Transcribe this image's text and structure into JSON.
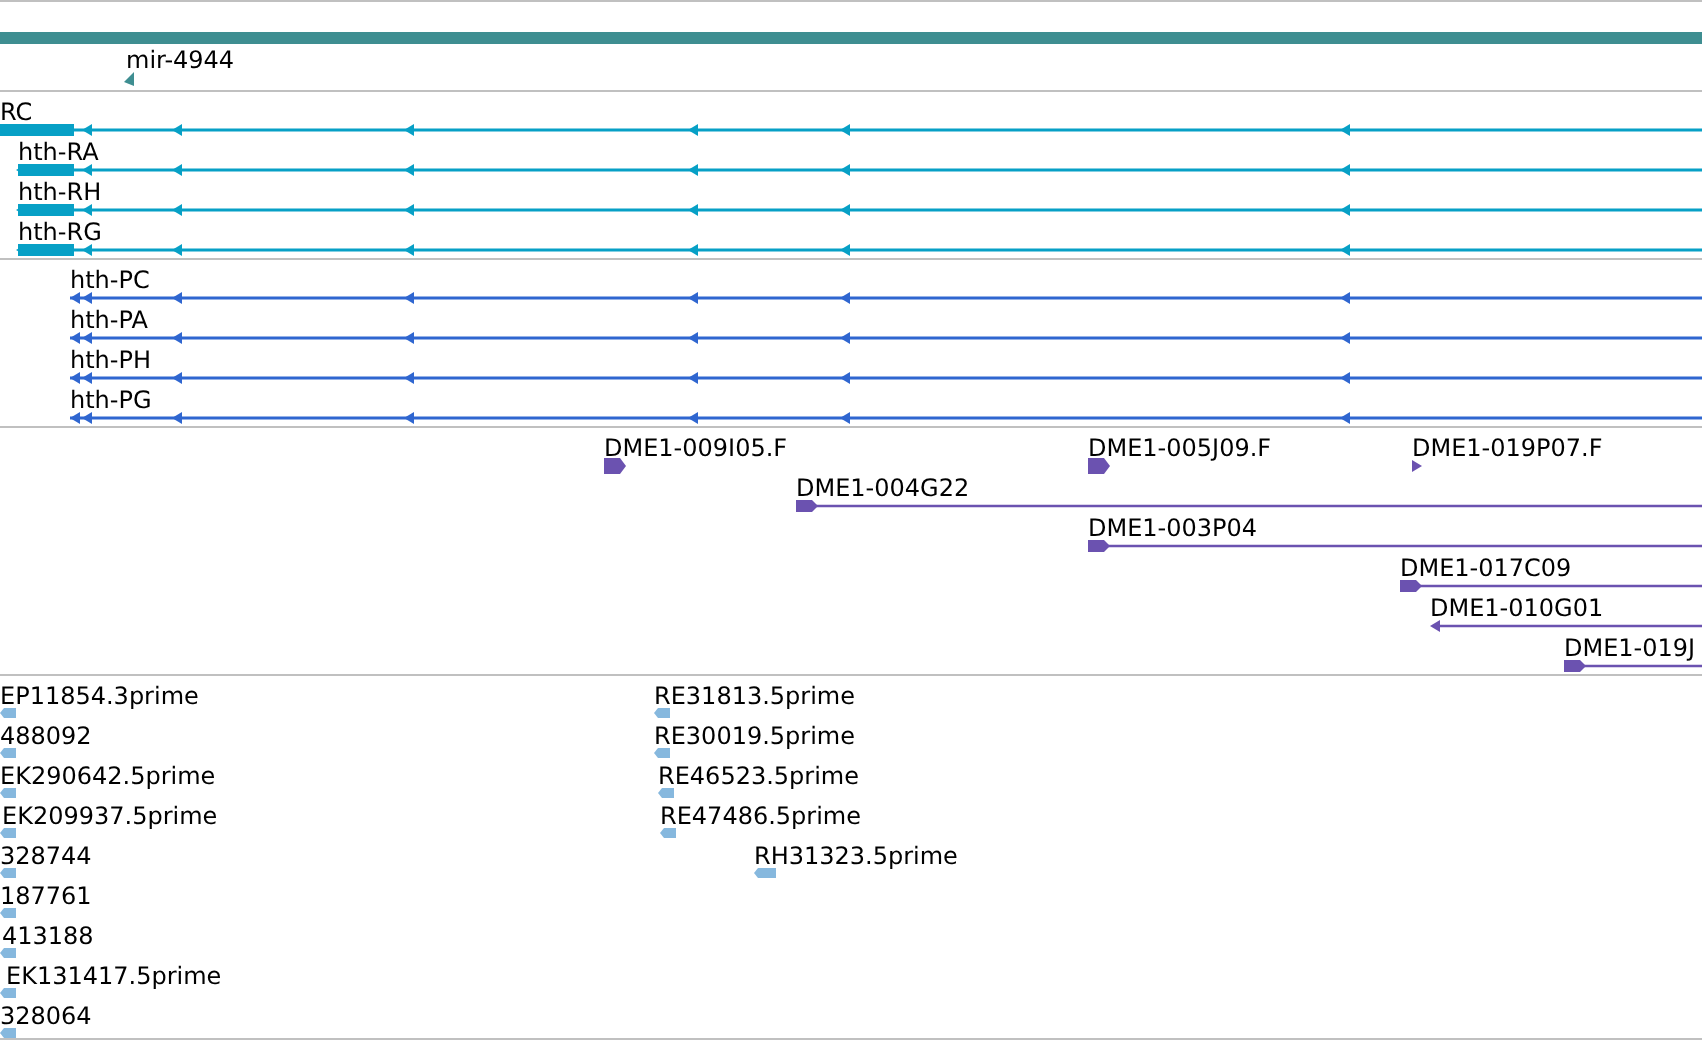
{
  "mirna": [
    {
      "label": "mir-4944"
    }
  ],
  "transcripts": [
    {
      "label": "RC"
    },
    {
      "label": "hth-RA"
    },
    {
      "label": "hth-RH"
    },
    {
      "label": "hth-RG"
    }
  ],
  "proteins": [
    {
      "label": "hth-PC"
    },
    {
      "label": "hth-PA"
    },
    {
      "label": "hth-PH"
    },
    {
      "label": "hth-PG"
    }
  ],
  "ests": [
    {
      "label": "DME1-009I05.F",
      "kind": "block"
    },
    {
      "label": "DME1-005J09.F",
      "kind": "block"
    },
    {
      "label": "DME1-019P07.F",
      "kind": "tick"
    },
    {
      "label": "DME1-004G22",
      "kind": "line"
    },
    {
      "label": "DME1-003P04",
      "kind": "line"
    },
    {
      "label": "DME1-017C09",
      "kind": "line"
    },
    {
      "label": "DME1-010G01",
      "kind": "reverse"
    },
    {
      "label": "DME1-019J",
      "kind": "line"
    }
  ],
  "reads": [
    {
      "label": "EP11854.3prime"
    },
    {
      "label": "488092"
    },
    {
      "label": "EK290642.5prime"
    },
    {
      "label": "EK209937.5prime"
    },
    {
      "label": "328744"
    },
    {
      "label": "187761"
    },
    {
      "label": "413188"
    },
    {
      "label": "EK131417.5prime"
    },
    {
      "label": "328064"
    },
    {
      "label": "RE31813.5prime"
    },
    {
      "label": "RE30019.5prime"
    },
    {
      "label": "RE46523.5prime"
    },
    {
      "label": "RE47486.5prime"
    },
    {
      "label": "RH31323.5prime"
    }
  ]
}
